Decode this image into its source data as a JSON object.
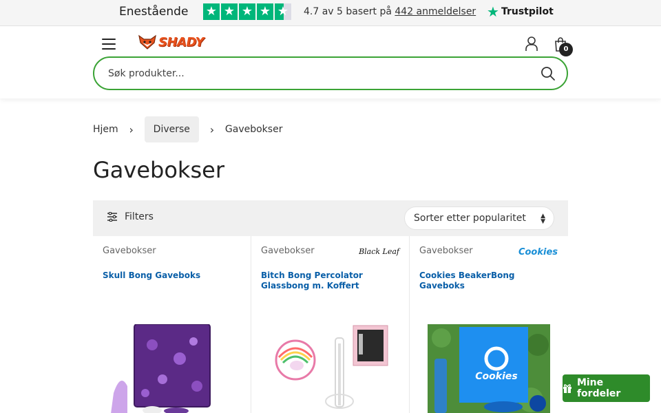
{
  "trustpilot": {
    "rating_word": "Enestående",
    "score_prefix": "4.7 av 5 basert på",
    "reviews_link": "442 anmeldelser",
    "brand": "Trustpilot",
    "star_color": "#00b67a"
  },
  "header": {
    "logo_text": "SHADY",
    "cart_count": "0",
    "search_placeholder": "Søk produkter..."
  },
  "breadcrumb": [
    "Hjem",
    "Diverse",
    "Gavebokser"
  ],
  "page_title": "Gavebokser",
  "filters": {
    "label": "Filters",
    "sort_value": "Sorter etter popularitet"
  },
  "products": [
    {
      "category": "Gavebokser",
      "brand": "",
      "title": "Skull Bong Gaveboks"
    },
    {
      "category": "Gavebokser",
      "brand": "Black Leaf",
      "title": "Bitch Bong Percolator Glassbong m. Koffert"
    },
    {
      "category": "Gavebokser",
      "brand": "Cookies",
      "title": "Cookies BeakerBong Gaveboks"
    }
  ],
  "floating_button": "Mine fordeler",
  "colors": {
    "accent_green": "#3aa335",
    "link_blue": "#0a5fa8",
    "button_green": "#2e8b2a"
  }
}
